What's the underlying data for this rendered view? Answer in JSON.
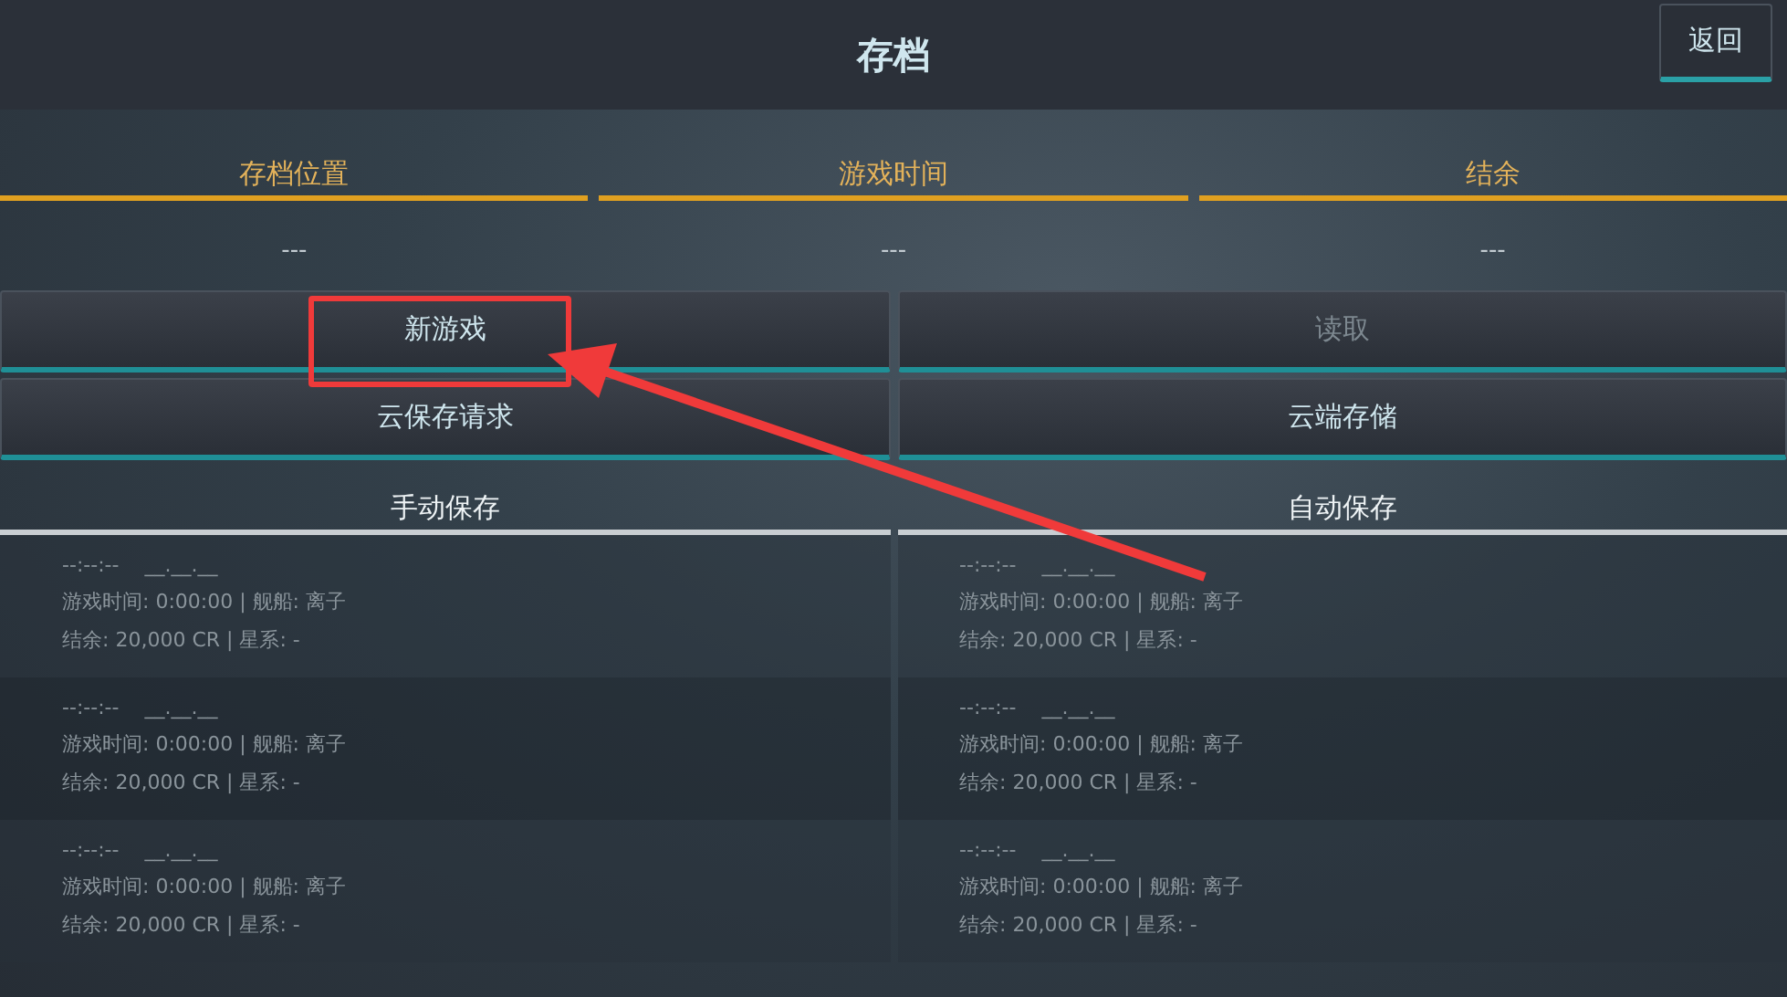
{
  "title": "存档",
  "back_button": "返回",
  "columns": [
    {
      "label": "存档位置",
      "value": "---"
    },
    {
      "label": "游戏时间",
      "value": "---"
    },
    {
      "label": "结余",
      "value": "---"
    }
  ],
  "button_rows": [
    [
      {
        "label": "新游戏",
        "disabled": false
      },
      {
        "label": "读取",
        "disabled": true
      }
    ],
    [
      {
        "label": "云保存请求",
        "disabled": false
      },
      {
        "label": "云端存储",
        "disabled": false
      }
    ]
  ],
  "sections": [
    {
      "title": "手动保存",
      "slots": [
        {
          "time": "--:--:--",
          "date": "__.__.__",
          "play_info": "游戏时间: 0:00:00 | 舰船: 离子",
          "balance_info": "结余: 20,000 CR | 星系: -"
        },
        {
          "time": "--:--:--",
          "date": "__.__.__",
          "play_info": "游戏时间: 0:00:00 | 舰船: 离子",
          "balance_info": "结余: 20,000 CR | 星系: -"
        },
        {
          "time": "--:--:--",
          "date": "__.__.__",
          "play_info": "游戏时间: 0:00:00 | 舰船: 离子",
          "balance_info": "结余: 20,000 CR | 星系: -"
        }
      ]
    },
    {
      "title": "自动保存",
      "slots": [
        {
          "time": "--:--:--",
          "date": "__.__.__",
          "play_info": "游戏时间: 0:00:00 | 舰船: 离子",
          "balance_info": "结余: 20,000 CR | 星系: -"
        },
        {
          "time": "--:--:--",
          "date": "__.__.__",
          "play_info": "游戏时间: 0:00:00 | 舰船: 离子",
          "balance_info": "结余: 20,000 CR | 星系: -"
        },
        {
          "time": "--:--:--",
          "date": "__.__.__",
          "play_info": "游戏时间: 0:00:00 | 舰船: 离子",
          "balance_info": "结余: 20,000 CR | 星系: -"
        }
      ]
    }
  ]
}
